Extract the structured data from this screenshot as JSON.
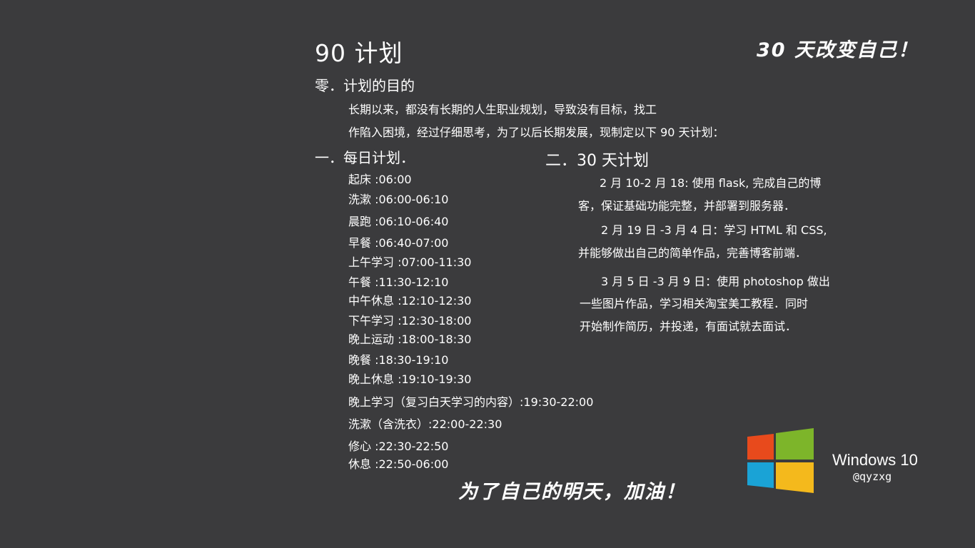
{
  "title": "90 计划",
  "slogan_top": "30 天改变自己！",
  "slogan_bottom": "为了自己的明天，加油！",
  "section0": {
    "heading": "零．计划的目的",
    "lines": [
      "长期以来，都没有长期的人生职业规划，导致没有目标，找工",
      "作陷入困境，经过仔细思考，为了以后长期发展，现制定以下 90 天计划："
    ]
  },
  "section1": {
    "heading": "一．每日计划．",
    "items": [
      "起床 :06:00",
      "洗漱 :06:00-06:10",
      "晨跑 :06:10-06:40",
      "早餐 :06:40-07:00",
      "上午学习 :07:00-11:30",
      "午餐 :11:30-12:10",
      "中午休息 :12:10-12:30",
      "下午学习 :12:30-18:00",
      "晚上运动 :18:00-18:30",
      "晚餐 :18:30-19:10",
      "晚上休息 :19:10-19:30",
      "晚上学习（复习白天学习的内容）:19:30-22:00",
      "洗漱（含洗衣）:22:00-22:30",
      "修心 :22:30-22:50",
      "休息 :22:50-06:00"
    ]
  },
  "section2": {
    "heading": "二．30 天计划",
    "lines": [
      "2 月 10-2 月 18: 使用 flask, 完成自己的博",
      "客，保证基础功能完整，并部署到服务器．",
      "2 月 19 日 -3 月 4 日：学习 HTML 和 CSS,",
      "并能够做出自己的简单作品，完善博客前端．",
      "3 月 5 日 -3 月 9 日：使用 photoshop 做出",
      "一些图片作品，学习相关淘宝美工教程．同时",
      "开始制作简历，并投递，有面试就去面试．"
    ]
  },
  "branding": {
    "os_name": "Windows 10",
    "user": "@qyzxg",
    "logo_colors": {
      "red": "#e84a1c",
      "green": "#7db52a",
      "blue": "#1aa3d6",
      "yellow": "#f4b91c"
    }
  }
}
